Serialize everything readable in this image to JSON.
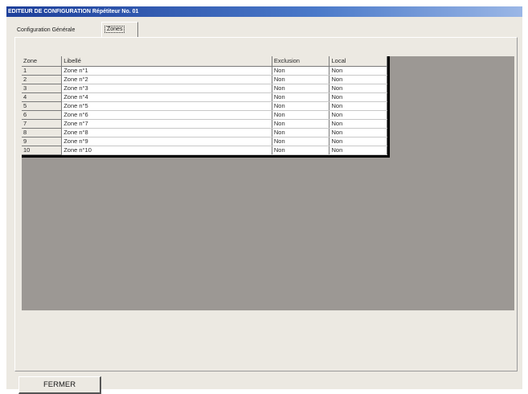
{
  "window": {
    "title": "EDITEUR DE CONFIGURATION Répétiteur No. 01"
  },
  "tabs": [
    {
      "label": "Configuration Générale",
      "active": false
    },
    {
      "label": "Zones",
      "active": true
    }
  ],
  "table": {
    "columns": [
      "Zone",
      "Libellé",
      "Exclusion",
      "Local"
    ],
    "rows": [
      {
        "zone": "1",
        "libelle": "Zone n°1",
        "exclusion": "Non",
        "local": "Non"
      },
      {
        "zone": "2",
        "libelle": "Zone n°2",
        "exclusion": "Non",
        "local": "Non"
      },
      {
        "zone": "3",
        "libelle": "Zone n°3",
        "exclusion": "Non",
        "local": "Non"
      },
      {
        "zone": "4",
        "libelle": "Zone n°4",
        "exclusion": "Non",
        "local": "Non"
      },
      {
        "zone": "5",
        "libelle": "Zone n°5",
        "exclusion": "Non",
        "local": "Non"
      },
      {
        "zone": "6",
        "libelle": "Zone n°6",
        "exclusion": "Non",
        "local": "Non"
      },
      {
        "zone": "7",
        "libelle": "Zone n°7",
        "exclusion": "Non",
        "local": "Non"
      },
      {
        "zone": "8",
        "libelle": "Zone n°8",
        "exclusion": "Non",
        "local": "Non"
      },
      {
        "zone": "9",
        "libelle": "Zone n°9",
        "exclusion": "Non",
        "local": "Non"
      },
      {
        "zone": "10",
        "libelle": "Zone n°10",
        "exclusion": "Non",
        "local": "Non"
      }
    ]
  },
  "buttons": {
    "fermer": "FERMER"
  },
  "colors": {
    "window_bg": "#ece9e2",
    "grid_area_bg": "#9c9894",
    "titlebar": "#1d3f9a"
  }
}
